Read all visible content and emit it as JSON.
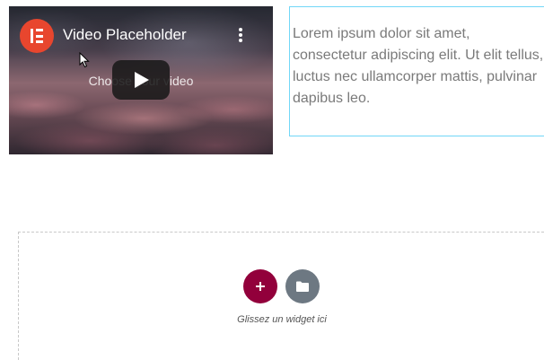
{
  "video_widget": {
    "title": "Video Placeholder",
    "choose_text": "Choose your video",
    "logo_icon": "elementor-logo-icon",
    "menu_icon": "kebab-menu-icon",
    "play_icon": "play-icon"
  },
  "text_widget": {
    "body": "Lorem ipsum dolor sit amet, consectetur adipiscing elit. Ut elit tellus, luctus nec ullamcorper mattis, pulvinar dapibus leo."
  },
  "empty_section": {
    "add_icon": "plus-icon",
    "template_icon": "folder-icon",
    "hint": "Glissez un widget ici"
  },
  "colors": {
    "elementor_logo": "#e8462e",
    "add_button": "#92003b",
    "template_button": "#6d7882",
    "text_widget_border": "#71d7f7",
    "body_text": "#7a7a7a"
  }
}
